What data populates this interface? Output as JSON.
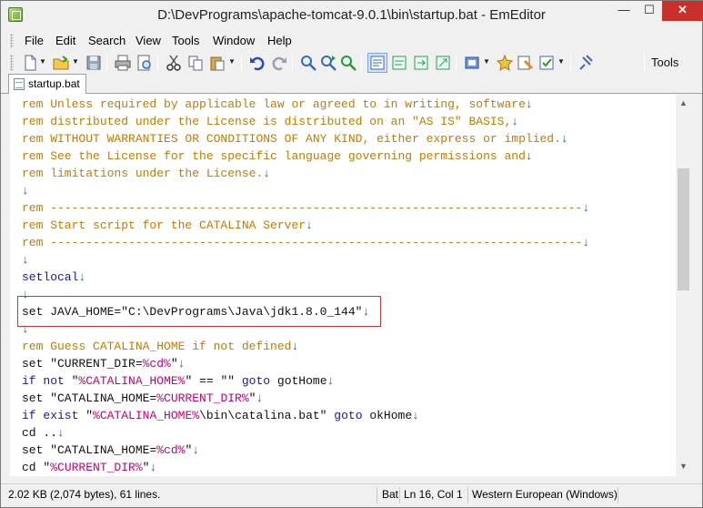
{
  "window": {
    "title": "D:\\DevPrograms\\apache-tomcat-9.0.1\\bin\\startup.bat - EmEditor",
    "minimize": "—",
    "maximize": "☐",
    "close": "✕"
  },
  "menu": [
    "File",
    "Edit",
    "Search",
    "View",
    "Tools",
    "Window",
    "Help"
  ],
  "toolbar": {
    "tools_label": "Tools"
  },
  "tab": {
    "label": "startup.bat"
  },
  "editor": {
    "eol_marker": "↓",
    "lines": [
      [
        {
          "t": "rem Unless required by applicable law or agreed to in writing, software",
          "c": "comment"
        }
      ],
      [
        {
          "t": "rem distributed under the License is distributed on an \"AS IS\" BASIS,",
          "c": "comment"
        }
      ],
      [
        {
          "t": "rem WITHOUT WARRANTIES OR CONDITIONS OF ANY KIND, either express or implied.",
          "c": "comment"
        }
      ],
      [
        {
          "t": "rem See the License for the specific language governing permissions and",
          "c": "comment"
        }
      ],
      [
        {
          "t": "rem limitations under the License.",
          "c": "comment"
        }
      ],
      [
        {
          "t": "",
          "c": "plain"
        }
      ],
      [
        {
          "t": "rem ---------------------------------------------------------------------------",
          "c": "comment"
        }
      ],
      [
        {
          "t": "rem Start script for the CATALINA Server",
          "c": "comment"
        }
      ],
      [
        {
          "t": "rem ---------------------------------------------------------------------------",
          "c": "comment"
        }
      ],
      [
        {
          "t": "",
          "c": "plain"
        }
      ],
      [
        {
          "t": "setlocal",
          "c": "kw"
        }
      ],
      [
        {
          "t": "",
          "c": "plain"
        }
      ],
      [
        {
          "t": "set JAVA_HOME=\"C:\\DevPrograms\\Java\\jdk1.8.0_144\"",
          "c": "plain"
        }
      ],
      [
        {
          "t": "",
          "c": "plain"
        }
      ],
      [
        {
          "t": "rem Guess CATALINA_HOME if not defined",
          "c": "comment"
        }
      ],
      [
        {
          "t": "set \"CURRENT_DIR=",
          "c": "plain"
        },
        {
          "t": "%cd%",
          "c": "var"
        },
        {
          "t": "\"",
          "c": "plain"
        }
      ],
      [
        {
          "t": "if not ",
          "c": "kw"
        },
        {
          "t": "\"",
          "c": "plain"
        },
        {
          "t": "%CATALINA_HOME%",
          "c": "var"
        },
        {
          "t": "\" == \"\" ",
          "c": "plain"
        },
        {
          "t": "goto",
          "c": "kw"
        },
        {
          "t": " gotHome",
          "c": "plain"
        }
      ],
      [
        {
          "t": "set \"CATALINA_HOME=",
          "c": "plain"
        },
        {
          "t": "%CURRENT_DIR%",
          "c": "var"
        },
        {
          "t": "\"",
          "c": "plain"
        }
      ],
      [
        {
          "t": "if exist ",
          "c": "kw"
        },
        {
          "t": "\"",
          "c": "plain"
        },
        {
          "t": "%CATALINA_HOME%",
          "c": "var"
        },
        {
          "t": "\\bin\\catalina.bat\" ",
          "c": "plain"
        },
        {
          "t": "goto",
          "c": "kw"
        },
        {
          "t": " okHome",
          "c": "plain"
        }
      ],
      [
        {
          "t": "cd ..",
          "c": "plain"
        }
      ],
      [
        {
          "t": "set \"CATALINA_HOME=",
          "c": "plain"
        },
        {
          "t": "%cd%",
          "c": "var"
        },
        {
          "t": "\"",
          "c": "plain"
        }
      ],
      [
        {
          "t": "cd \"",
          "c": "plain"
        },
        {
          "t": "%CURRENT_DIR%",
          "c": "var"
        },
        {
          "t": "\"",
          "c": "plain"
        }
      ]
    ]
  },
  "status": {
    "size": "2.02 KB (2,074 bytes), 61 lines.",
    "mode": "Bat",
    "position": "Ln 16, Col 1",
    "encoding": "Western European (Windows)"
  },
  "colors": {
    "comment": "#c87800",
    "keyword": "#1010d8",
    "variable": "#c8007a",
    "eol": "#1a5cd8",
    "highlight_box": "#d83030",
    "close_button": "#c7312a"
  }
}
